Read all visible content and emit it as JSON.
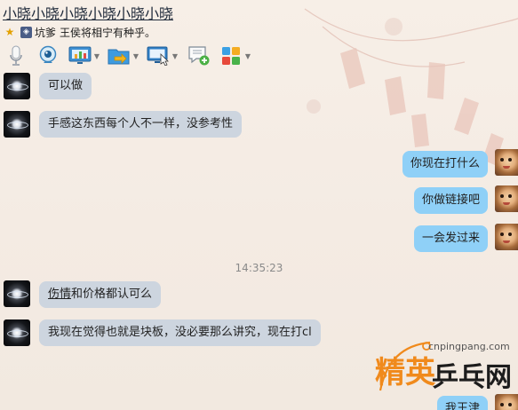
{
  "window": {
    "title": "小晓小晓小晓小晓小晓小晓",
    "signature_prefix": "坑爹",
    "signature_text": "王侯将相宁有种乎。"
  },
  "toolbar": {
    "items": [
      {
        "icon": "microphone-icon",
        "has_dropdown": false
      },
      {
        "icon": "webcam-icon",
        "has_dropdown": false
      },
      {
        "icon": "screen-share-icon",
        "has_dropdown": true
      },
      {
        "icon": "send-file-icon",
        "has_dropdown": true
      },
      {
        "icon": "remote-desktop-icon",
        "has_dropdown": true
      },
      {
        "icon": "new-message-icon",
        "has_dropdown": false
      },
      {
        "icon": "apps-icon",
        "has_dropdown": true
      }
    ]
  },
  "messages": [
    {
      "side": "left",
      "text": "可以做"
    },
    {
      "side": "left",
      "text": "手感这东西每个人不一样，没参考性"
    },
    {
      "side": "right",
      "text": "你现在打什么"
    },
    {
      "side": "right",
      "text": "你做链接吧"
    },
    {
      "side": "right",
      "text": "一会发过来"
    },
    {
      "side": "left",
      "text_underlined": "伤情",
      "text": "和价格都认可么"
    },
    {
      "side": "left",
      "text": "我现在觉得也就是块板，没必要那么讲究，现在打cl"
    },
    {
      "side": "right",
      "text": "我王津"
    }
  ],
  "timestamp": "14:35:23",
  "watermark": {
    "url": "cnpingpang.com",
    "brand_left": "精英",
    "brand_right": "乒乓网"
  },
  "colors": {
    "bubble_self": "#8fd0f7",
    "bubble_other": "#cdd5df",
    "title": "#1f2a3a",
    "watermark_orange": "#f08a1c"
  }
}
